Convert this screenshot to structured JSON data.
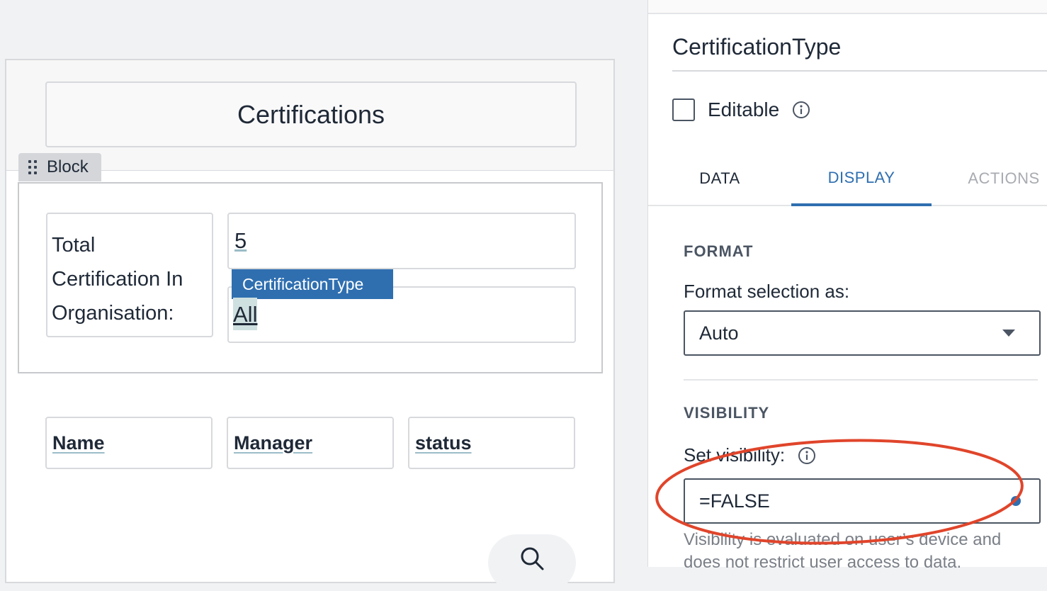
{
  "canvas": {
    "header_title": "Certifications",
    "block_tag": "Block",
    "total_label": "Total Certification In Organisation:",
    "total_value": "5",
    "type_tag": "CertificationType",
    "type_value": "All",
    "columns": [
      "Name",
      "Manager",
      "status"
    ]
  },
  "panel": {
    "component_name": "CertificationType",
    "editable_label": "Editable",
    "tabs": {
      "data": "DATA",
      "display": "DISPLAY",
      "actions": "ACTIONS"
    },
    "format_section": "FORMAT",
    "format_label": "Format selection as:",
    "format_value": "Auto",
    "visibility_section": "VISIBILITY",
    "visibility_label": "Set visibility:",
    "visibility_value": "=FALSE",
    "visibility_help": "Visibility is evaluated on user’s device and does not restrict user access to data."
  },
  "colors": {
    "accent": "#2f6fb0",
    "annotation": "#e0452b"
  },
  "icons": [
    "drag-handle-icon",
    "info-icon",
    "chevron-down-icon",
    "search-icon"
  ]
}
